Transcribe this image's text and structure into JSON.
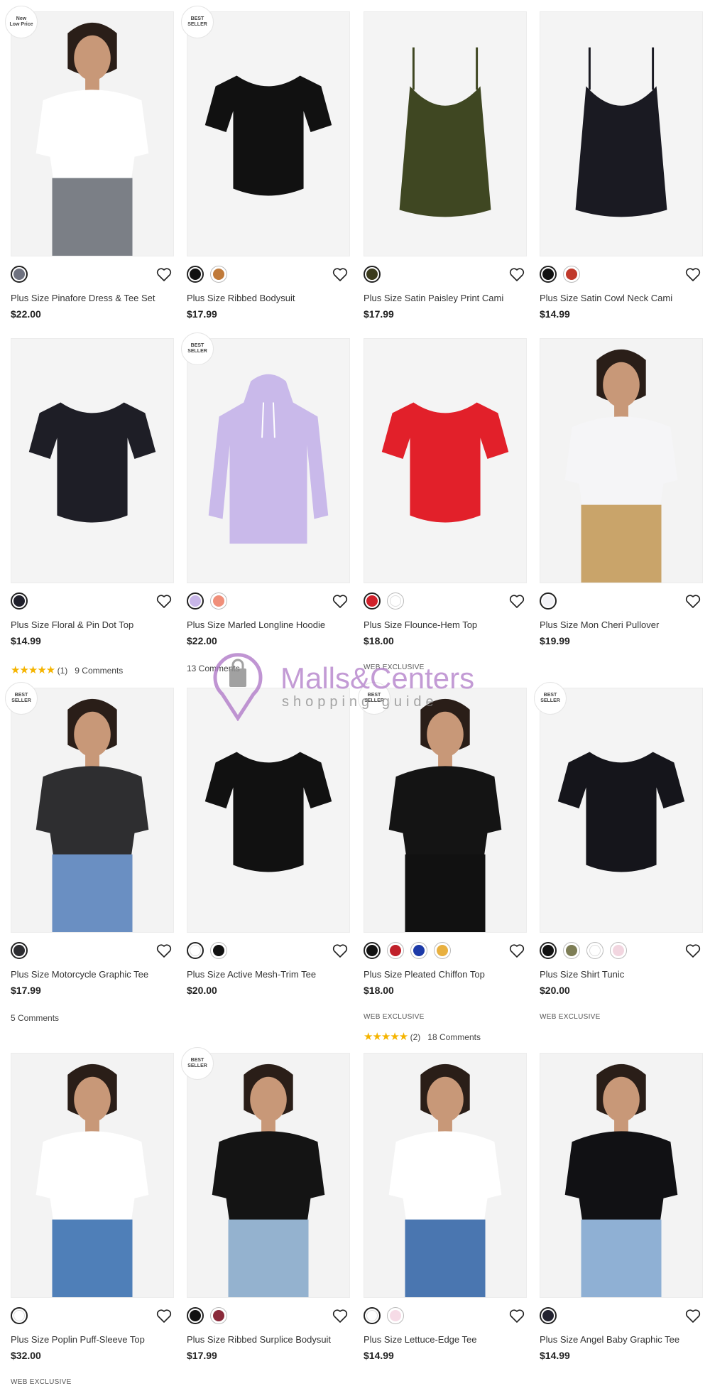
{
  "products": [
    {
      "badge": "New\nLow Price",
      "name": "Plus Size Pinafore Dress & Tee Set",
      "price": "$22.00",
      "swatches": [
        "#6f7280"
      ],
      "kind": "model",
      "garment": "#7b7f86",
      "top": "#ffffff"
    },
    {
      "badge": "BEST\nSELLER",
      "name": "Plus Size Ribbed Bodysuit",
      "price": "$17.99",
      "swatches": [
        "#111111",
        "#c07a3a"
      ],
      "kind": "flat",
      "garment": "#111111"
    },
    {
      "badge": "",
      "name": "Plus Size Satin Paisley Print Cami",
      "price": "$17.99",
      "swatches": [
        "#3a3a1c"
      ],
      "kind": "cami",
      "garment": "#3f4722"
    },
    {
      "badge": "",
      "name": "Plus Size Satin Cowl Neck Cami",
      "price": "$14.99",
      "swatches": [
        "#111111",
        "#c0392b"
      ],
      "kind": "cami",
      "garment": "#1a1a22"
    },
    {
      "badge": "",
      "name": "Plus Size Floral & Pin Dot Top",
      "price": "$14.99",
      "swatches": [
        "#1f1f2a"
      ],
      "kind": "flat",
      "garment": "#1e1e26",
      "rating": "(1)",
      "comments": "9 Comments"
    },
    {
      "badge": "BEST\nSELLER",
      "name": "Plus Size Marled Longline Hoodie",
      "price": "$22.00",
      "swatches": [
        "#c8b6e8",
        "#f08f7a"
      ],
      "kind": "hoodie",
      "garment": "#c9b9ea",
      "comments": "13 Comments"
    },
    {
      "badge": "",
      "name": "Plus Size Flounce-Hem Top",
      "price": "$18.00",
      "swatches": [
        "#d0202a",
        "#ffffff"
      ],
      "kind": "flat",
      "garment": "#e2202a",
      "web": "WEB EXCLUSIVE"
    },
    {
      "badge": "",
      "name": "Plus Size Mon Cheri Pullover",
      "price": "$19.99",
      "swatches": [
        "#f2f2f6"
      ],
      "kind": "model",
      "garment": "#c9a46a",
      "top": "#f5f5f7"
    },
    {
      "badge": "BEST\nSELLER",
      "name": "Plus Size Motorcycle Graphic Tee",
      "price": "$17.99",
      "swatches": [
        "#2c2c30"
      ],
      "kind": "model",
      "garment": "#6a8fc2",
      "top": "#2e2e30",
      "comments": "5 Comments"
    },
    {
      "badge": "",
      "name": "Plus Size Active Mesh-Trim Tee",
      "price": "$20.00",
      "swatches": [
        "#ffffff",
        "#111111"
      ],
      "kind": "flat",
      "garment": "#111111"
    },
    {
      "badge": "BEST\nSELLER",
      "name": "Plus Size Pleated Chiffon Top",
      "price": "$18.00",
      "swatches": [
        "#111111",
        "#c0202a",
        "#1c3aa8",
        "#e8b040"
      ],
      "kind": "model",
      "garment": "#111111",
      "top": "#141414",
      "web": "WEB EXCLUSIVE",
      "rating": "(2)",
      "comments": "18 Comments"
    },
    {
      "badge": "BEST\nSELLER",
      "name": "Plus Size Shirt Tunic",
      "price": "$20.00",
      "swatches": [
        "#111111",
        "#7d7d55",
        "#ffffff",
        "#f2d6e0"
      ],
      "kind": "flat",
      "garment": "#15151b",
      "web": "WEB EXCLUSIVE"
    },
    {
      "badge": "",
      "name": "Plus Size Poplin Puff-Sleeve Top",
      "price": "$32.00",
      "swatches": [
        "#ffffff"
      ],
      "kind": "model",
      "garment": "#4f7fb8",
      "top": "#ffffff",
      "web": "WEB EXCLUSIVE"
    },
    {
      "badge": "BEST\nSELLER",
      "name": "Plus Size Ribbed Surplice Bodysuit",
      "price": "$17.99",
      "swatches": [
        "#111111",
        "#8a2a3a"
      ],
      "kind": "model",
      "garment": "#94b2cf",
      "top": "#141414"
    },
    {
      "badge": "",
      "name": "Plus Size Lettuce-Edge Tee",
      "price": "$14.99",
      "swatches": [
        "#ffffff",
        "#f6dbe6"
      ],
      "kind": "model",
      "garment": "#4a76b0",
      "top": "#ffffff"
    },
    {
      "badge": "",
      "name": "Plus Size Angel Baby Graphic Tee",
      "price": "$14.99",
      "swatches": [
        "#232330"
      ],
      "kind": "model",
      "garment": "#8fb0d4",
      "top": "#111114"
    }
  ],
  "watermark": {
    "brand": "Malls&Centers",
    "sub": "shopping guide"
  },
  "colors": {
    "star": "#f5b400",
    "watermark": "#b07ac8"
  }
}
